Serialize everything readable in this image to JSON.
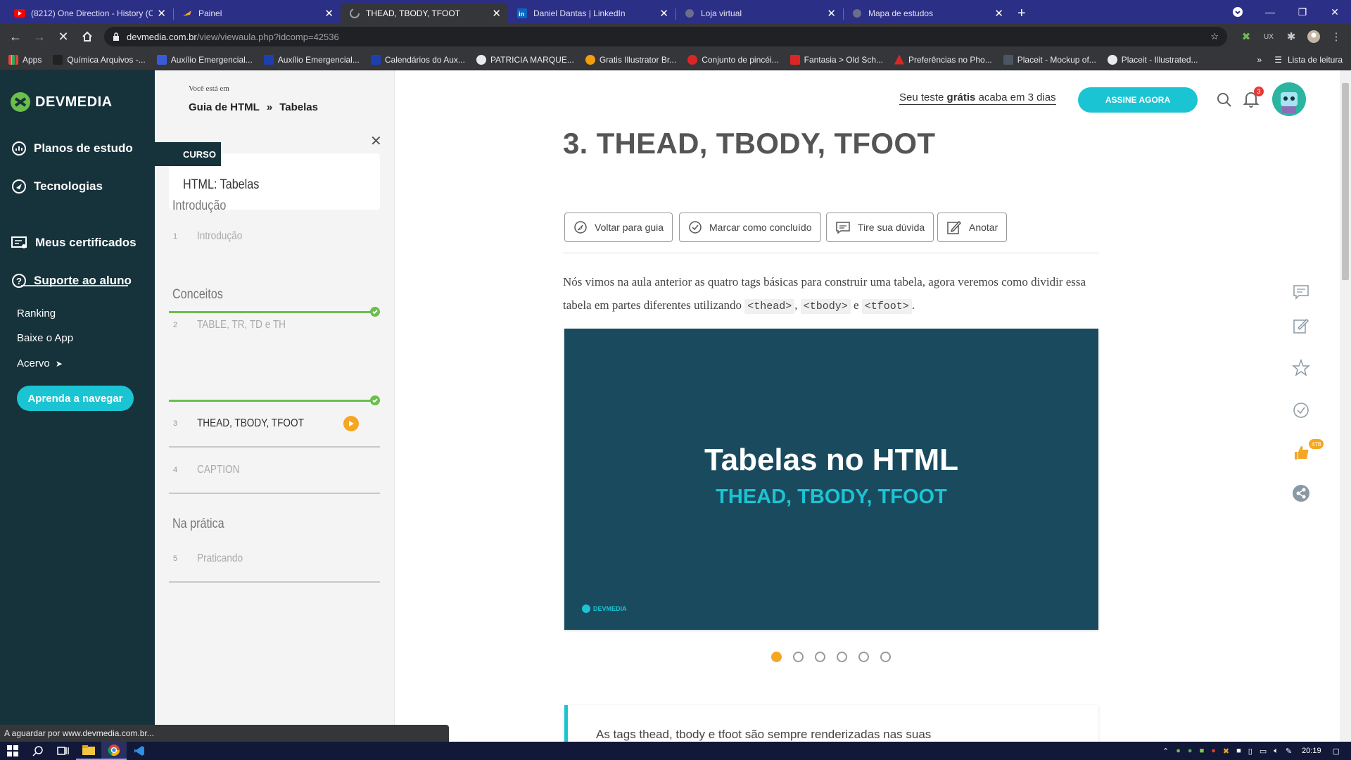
{
  "browser": {
    "tabs": [
      {
        "title": "(8212) One Direction - History (C",
        "icon": "youtube-icon",
        "color": "#ff0000"
      },
      {
        "title": "Painel",
        "icon": "painel-icon",
        "color": "#f5a623"
      },
      {
        "title": "THEAD, TBODY, TFOOT",
        "icon": "loading-icon",
        "color": "#9aa0a6",
        "active": true
      },
      {
        "title": "Daniel Dantas | LinkedIn",
        "icon": "linkedin-icon",
        "color": "#0a66c2"
      },
      {
        "title": "Loja virtual",
        "icon": "globe-icon",
        "color": "#9aa0a6"
      },
      {
        "title": "Mapa de estudos",
        "icon": "globe-icon",
        "color": "#9aa0a6"
      }
    ],
    "url_host": "devmedia.com.br",
    "url_path": "/view/viewaula.php?idcomp=42536",
    "bookmarks": [
      {
        "label": "Apps",
        "color": "#e8eaed"
      },
      {
        "label": "Química Arquivos -...",
        "color": "#222222"
      },
      {
        "label": "Auxílio Emergencial...",
        "color": "#3a5bd9"
      },
      {
        "label": "Auxílio Emergencial...",
        "color": "#1e40af"
      },
      {
        "label": "Calendários do Aux...",
        "color": "#1e40af"
      },
      {
        "label": "PATRICIA MARQUE...",
        "color": "#e8eaed"
      },
      {
        "label": "Gratis Illustrator Br...",
        "color": "#f59e0b"
      },
      {
        "label": "Conjunto de pincéi...",
        "color": "#dc2626"
      },
      {
        "label": "Fantasia > Old Sch...",
        "color": "#dc2626"
      },
      {
        "label": "Preferências no Pho...",
        "color": "#dc2626"
      },
      {
        "label": "Placeit - Mockup of...",
        "color": "#4b5563"
      },
      {
        "label": "Placeit - Illustrated...",
        "color": "#e8eaed"
      }
    ],
    "bookmarks_more": "»",
    "reading_list": "Lista de leitura",
    "status": "A aguardar por www.devmedia.com.br..."
  },
  "sidebar": {
    "logo": "DEVMEDIA",
    "items": [
      {
        "label": "Planos de estudo",
        "icon": "study-plans-icon"
      },
      {
        "label": "Tecnologias",
        "icon": "technologies-icon"
      },
      {
        "label": "Meus certificados",
        "icon": "certificate-icon"
      },
      {
        "label": "Suporte ao aluno",
        "icon": "help-icon"
      }
    ],
    "links": [
      "Ranking",
      "Baixe o App",
      "Acervo"
    ],
    "acervo_arrow": "➤",
    "cta": "Aprenda a navegar"
  },
  "header": {
    "you_are_in": "Você está em",
    "crumb1": "Guia de HTML",
    "crumb_sep": "»",
    "crumb2": "Tabelas",
    "trial_pre": "Seu teste ",
    "trial_bold": "grátis",
    "trial_post": " acaba em 3 dias",
    "subscribe": "ASSINE AGORA",
    "notifications": "3"
  },
  "course": {
    "tag": "CURSO",
    "title": "HTML: Tabelas",
    "sections": [
      {
        "name": "Introdução"
      },
      {
        "name": "Conceitos"
      },
      {
        "name": "Na prática"
      }
    ],
    "lessons": [
      {
        "num": "1",
        "name": "Introdução"
      },
      {
        "num": "2",
        "name": "TABLE, TR, TD e TH"
      },
      {
        "num": "3",
        "name": "THEAD, TBODY, TFOOT"
      },
      {
        "num": "4",
        "name": "CAPTION"
      },
      {
        "num": "5",
        "name": "Praticando"
      }
    ]
  },
  "lesson": {
    "title": "3. THEAD, TBODY, TFOOT",
    "actions": [
      "Voltar para guia",
      "Marcar como concluído",
      "Tire sua dúvida",
      "Anotar"
    ],
    "intro_1": "Nós vimos na aula anterior as quatro tags básicas para construir uma tabela, agora veremos como dividir essa tabela em partes diferentes utilizando ",
    "code_thead": "<thead>",
    "comma": ", ",
    "code_tbody": "<tbody>",
    "and": " e ",
    "code_tfoot": "<tfoot>",
    "period": ".",
    "slide_title": "Tabelas no HTML",
    "slide_subtitle": "THEAD, TBODY, TFOOT",
    "slide_logo": "DEVMEDIA",
    "note_text": "As tags thead, tbody e tfoot são sempre renderizadas nas suas"
  },
  "rail": {
    "likes": "478"
  },
  "taskbar": {
    "time": "20:19"
  },
  "colors": {
    "accent": "#1bc4d3",
    "dark": "#16323b",
    "orange": "#f5a623",
    "green": "#6abf4b"
  }
}
